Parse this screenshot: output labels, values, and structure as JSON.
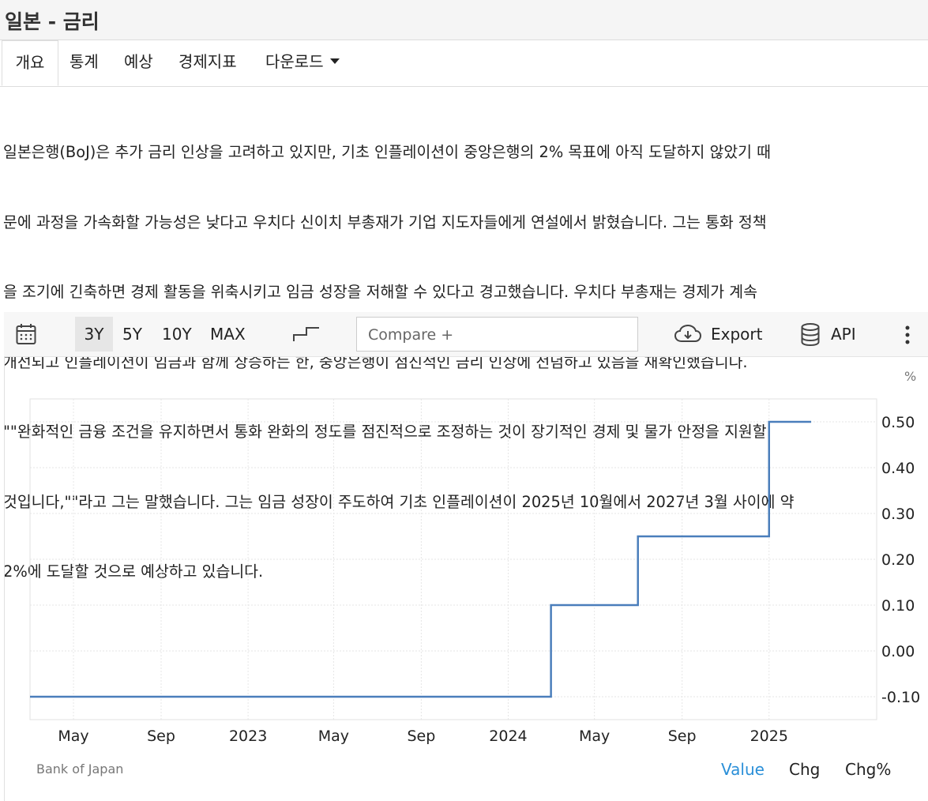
{
  "header": {
    "title": "일본 - 금리"
  },
  "tabs": [
    {
      "label": "개요"
    },
    {
      "label": "통계"
    },
    {
      "label": "예상"
    },
    {
      "label": "경제지표"
    },
    {
      "label": "다운로드"
    }
  ],
  "description": {
    "lines": [
      "일본은행(BoJ)은 추가 금리 인상을 고려하고 있지만, 기초 인플레이션이 중앙은행의 2% 목표에 아직 도달하지 않았기 때",
      "문에 과정을 가속화할 가능성은 낮다고 우치다 신이치 부총재가 기업 지도자들에게 연설에서 밝혔습니다. 그는 통화 정책",
      "을 조기에 긴축하면 경제 활동을 위축시키고 임금 성장을 저해할 수 있다고 경고했습니다. 우치다 부총재는 경제가 계속",
      "개선되고 인플레이션이 임금과 함께 상승하는 한, 중앙은행이 점진적인 금리 인상에 전념하고 있음을 재확인했습니다.",
      "\"\"완화적인 금융 조건을 유지하면서 통화 완화의 정도를 점진적으로 조정하는 것이 장기적인 경제 및 물가 안정을 지원할",
      "것입니다,\"\"라고 그는 말했습니다. 그는 임금 성장이 주도하여 기초 인플레이션이 2025년 10월에서 2027년 3월 사이에 약",
      "2%에 도달할 것으로 예상하고 있습니다."
    ]
  },
  "toolbar": {
    "ranges": [
      "3Y",
      "5Y",
      "10Y",
      "MAX"
    ],
    "selected_range": "3Y",
    "compare_placeholder": "Compare  +",
    "export_label": "Export",
    "api_label": "API",
    "icons": [
      "calendar-icon",
      "step-chart-icon",
      "cloud-download-icon",
      "database-icon",
      "more-vertical-icon"
    ]
  },
  "chart_data": {
    "type": "line",
    "step": true,
    "unit": "%",
    "x_ticks": [
      "May",
      "Sep",
      "2023",
      "May",
      "Sep",
      "2024",
      "May",
      "Sep",
      "2025"
    ],
    "y_ticks": [
      "0.50",
      "0.40",
      "0.30",
      "0.20",
      "0.10",
      "0.00",
      "-0.10"
    ],
    "ylim": [
      -0.15,
      0.55
    ],
    "series": [
      {
        "color": "#4a7ebb",
        "points": [
          {
            "date": "2022-03",
            "value": -0.1
          },
          {
            "date": "2024-03",
            "value": 0.1
          },
          {
            "date": "2024-07",
            "value": 0.25
          },
          {
            "date": "2025-01",
            "value": 0.5
          },
          {
            "date": "2025-03",
            "value": 0.5
          }
        ]
      }
    ],
    "grid": true
  },
  "footer": {
    "source": "Bank of Japan",
    "value_label": "Value",
    "chg_label": "Chg",
    "chgpct_label": "Chg%",
    "active_color": "#2a8fd8"
  }
}
